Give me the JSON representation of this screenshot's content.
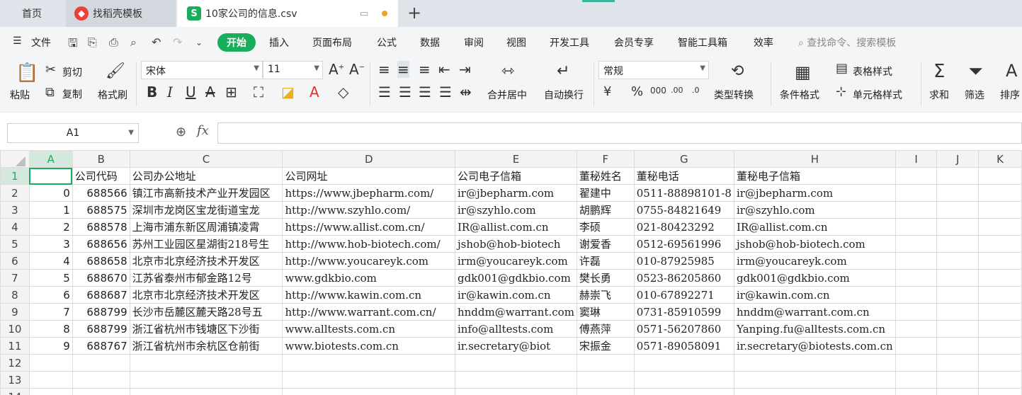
{
  "tabs": {
    "home": "首页",
    "template": "找稻壳模板",
    "file": "10家公司的信息.csv"
  },
  "menu": {
    "file": "文件",
    "items": [
      "开始",
      "插入",
      "页面布局",
      "公式",
      "数据",
      "审阅",
      "视图",
      "开发工具",
      "会员专享",
      "智能工具箱",
      "效率"
    ],
    "search": "查找命令、搜索模板"
  },
  "ribbon": {
    "paste": "粘贴",
    "cut": "剪切",
    "copy": "复制",
    "format_painter": "格式刷",
    "font_name": "宋体",
    "font_size": "11",
    "merge": "合并居中",
    "wrap": "自动换行",
    "number_format": "常规",
    "type_convert": "类型转换",
    "cond_format": "条件格式",
    "table_style": "表格样式",
    "cell_style": "单元格样式",
    "sum": "求和",
    "filter": "筛选",
    "sort": "排序"
  },
  "formula_bar": {
    "name_box": "A1",
    "fx": "fx",
    "formula": ""
  },
  "sheet": {
    "columns": [
      "A",
      "B",
      "C",
      "D",
      "E",
      "F",
      "G",
      "H",
      "I",
      "J",
      "K"
    ],
    "rows": [
      {
        "n": "1",
        "cells": [
          "",
          "公司代码",
          "公司办公地址",
          "公司网址",
          "公司电子信箱",
          "董秘姓名",
          "董秘电话",
          "董秘电子信箱",
          "",
          "",
          ""
        ]
      },
      {
        "n": "2",
        "cells": [
          "0",
          "688566",
          "镇江市高新技术产业开发园区",
          "https://www.jbepharm.com/",
          "ir@jbepharm.com",
          "翟建中",
          "0511-88898101-8",
          "ir@jbepharm.com",
          "",
          "",
          ""
        ]
      },
      {
        "n": "3",
        "cells": [
          "1",
          "688575",
          "深圳市龙岗区宝龙街道宝龙",
          "http://www.szyhlo.com/",
          "ir@szyhlo.com",
          "胡鹏辉",
          "0755-84821649",
          "ir@szyhlo.com",
          "",
          "",
          ""
        ]
      },
      {
        "n": "4",
        "cells": [
          "2",
          "688578",
          "上海市浦东新区周浦镇凌霄",
          "https://www.allist.com.cn/",
          "IR@allist.com.cn",
          "李硕",
          "021-80423292",
          "IR@allist.com.cn",
          "",
          "",
          ""
        ]
      },
      {
        "n": "5",
        "cells": [
          "3",
          "688656",
          "苏州工业园区星湖街218号生",
          "http://www.hob-biotech.com/",
          "jshob@hob-biotech",
          "谢爱香",
          "0512-69561996",
          "jshob@hob-biotech.com",
          "",
          "",
          ""
        ]
      },
      {
        "n": "6",
        "cells": [
          "4",
          "688658",
          "北京市北京经济技术开发区",
          "http://www.youcareyk.com",
          "irm@youcareyk.com",
          "许磊",
          "010-87925985",
          "irm@youcareyk.com",
          "",
          "",
          ""
        ]
      },
      {
        "n": "7",
        "cells": [
          "5",
          "688670",
          "江苏省泰州市郁金路12号",
          "www.gdkbio.com",
          "gdk001@gdkbio.com",
          "樊长勇",
          "0523-86205860",
          "gdk001@gdkbio.com",
          "",
          "",
          ""
        ]
      },
      {
        "n": "8",
        "cells": [
          "6",
          "688687",
          "北京市北京经济技术开发区",
          "http://www.kawin.com.cn",
          "ir@kawin.com.cn",
          "赫崇飞",
          "010-67892271",
          "ir@kawin.com.cn",
          "",
          "",
          ""
        ]
      },
      {
        "n": "9",
        "cells": [
          "7",
          "688799",
          "长沙市岳麓区麓天路28号五",
          "http://www.warrant.com.cn/",
          "hnddm@warrant.com",
          "窦琳",
          "0731-85910599",
          "hnddm@warrant.com.cn",
          "",
          "",
          ""
        ]
      },
      {
        "n": "10",
        "cells": [
          "8",
          "688799",
          "浙江省杭州市钱塘区下沙街",
          "www.alltests.com.cn",
          "info@alltests.com",
          "傅燕萍",
          "0571-56207860",
          "Yanping.fu@alltests.com.cn",
          "",
          "",
          ""
        ]
      },
      {
        "n": "11",
        "cells": [
          "9",
          "688767",
          "浙江省杭州市余杭区仓前街",
          "www.biotests.com.cn",
          "ir.secretary@biot",
          "宋振金",
          "0571-89058091",
          "ir.secretary@biotests.com.cn",
          "",
          "",
          ""
        ]
      },
      {
        "n": "12",
        "cells": [
          "",
          "",
          "",
          "",
          "",
          "",
          "",
          "",
          "",
          "",
          ""
        ]
      },
      {
        "n": "13",
        "cells": [
          "",
          "",
          "",
          "",
          "",
          "",
          "",
          "",
          "",
          "",
          ""
        ]
      },
      {
        "n": "14",
        "cells": [
          "",
          "",
          "",
          "",
          "",
          "",
          "",
          "",
          "",
          "",
          ""
        ]
      }
    ]
  },
  "colors": {
    "accent": "#1aae5c",
    "tab_bar": "#dfe3ea",
    "ribbon_bg": "#f4f5f7",
    "selection": "#1aae5c"
  }
}
